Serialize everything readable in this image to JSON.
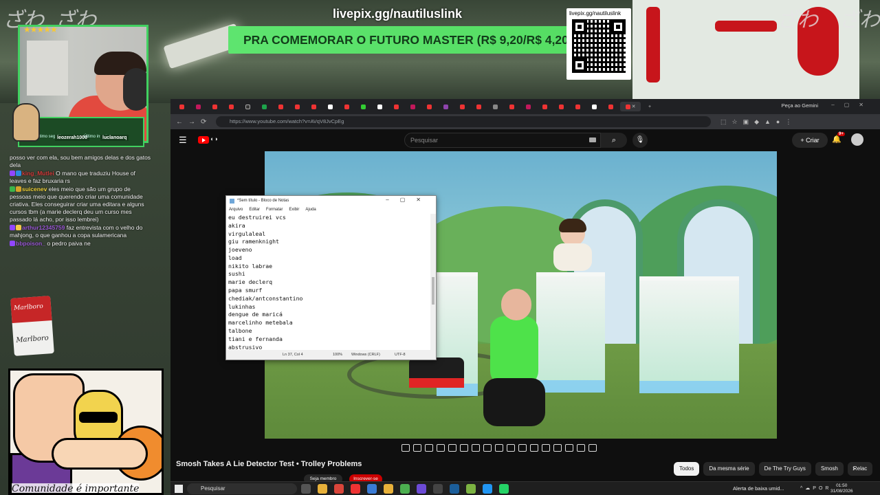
{
  "overlay": {
    "livepix_url": "livepix.gg/nautiluslink",
    "banner_text": "PRA COMEMORAR O FUTURO MASTER (R$ 9,20/R$ 4,20)",
    "qr_label": "livepix.gg/nautiluslink",
    "deco_glyphs": "ざわ",
    "cam_follower_label": "Último seguidor:",
    "cam_follower": "leozerah1000",
    "cam_sub_label": "Último inscrito:",
    "cam_sub": "luclanoarq",
    "cig_brand": "Marlboro",
    "cartoon_caption": "Comunidade é importante",
    "accent": "#41d160"
  },
  "chat": [
    {
      "user": "",
      "color": "#ffffff",
      "text": "posso ver com ela, sou bem amigos delas e dos gatos dela"
    },
    {
      "user": "king_Mutlei",
      "color": "#d23b3b",
      "text": "O mano que traduziu House of leaves e faz bruxaria rs"
    },
    {
      "user": "suicenev",
      "color": "#f0d23a",
      "text": "eles meio que são um grupo de pessoas meio que querendo criar uma comunidade criativa. Eles conseguirar criar uma editara e alguns cursos tbm (a marie declerq deu um curso mes passado lá acho, por isso lembrei)"
    },
    {
      "user": "arthur12345759",
      "color": "#9b59d6",
      "text": "faz entrevista com o velho do mahjong, o que ganhou a copa sulamericana"
    },
    {
      "user": "bbpoison_",
      "color": "#9b59d6",
      "text": "o pedro paiva ne"
    }
  ],
  "browser": {
    "gemini_label": "Peça ao Gemini",
    "url": "https://www.youtube.com/watch?v=AVqV8JvCpEg",
    "search_placeholder": "Pesquisar",
    "criar_label": "Criar",
    "bell_badge": "9+",
    "video_title": "Smosh Takes A Lie Detector Test • Trolley Problems",
    "member_label": "Seja membro",
    "subscribe_label": "Inscrever-se",
    "chips": [
      "Todos",
      "Da mesma série",
      "De The Try Guys",
      "Smosh",
      "Relac"
    ]
  },
  "notepad": {
    "title": "*Sem título - Bloco de Notas",
    "menu": [
      "Arquivo",
      "Editar",
      "Formatar",
      "Exibir",
      "Ajuda"
    ],
    "lines": [
      "eu destruirei vcs",
      "akira",
      "virgulaleal",
      "giu ramenknight",
      "joeveno",
      "load",
      "nikito labrae",
      "sushi",
      "marie declerq",
      "papa smurf",
      "chediak/antconstantino",
      "lukinhas",
      "dengue de maricá",
      "marcelinho metebala",
      "talbone",
      "tiani e fernanda",
      "abstrusivo"
    ],
    "status_pos": "Ln 37, Col 4",
    "status_zoom": "100%",
    "status_eol": "Windows (CRLF)",
    "status_enc": "UTF-8"
  },
  "taskbar": {
    "search_placeholder": "Pesquisar",
    "alert": "Alerta de baixa umid...",
    "lang": "POR",
    "time": "01:50",
    "date": "31/08/2026"
  }
}
